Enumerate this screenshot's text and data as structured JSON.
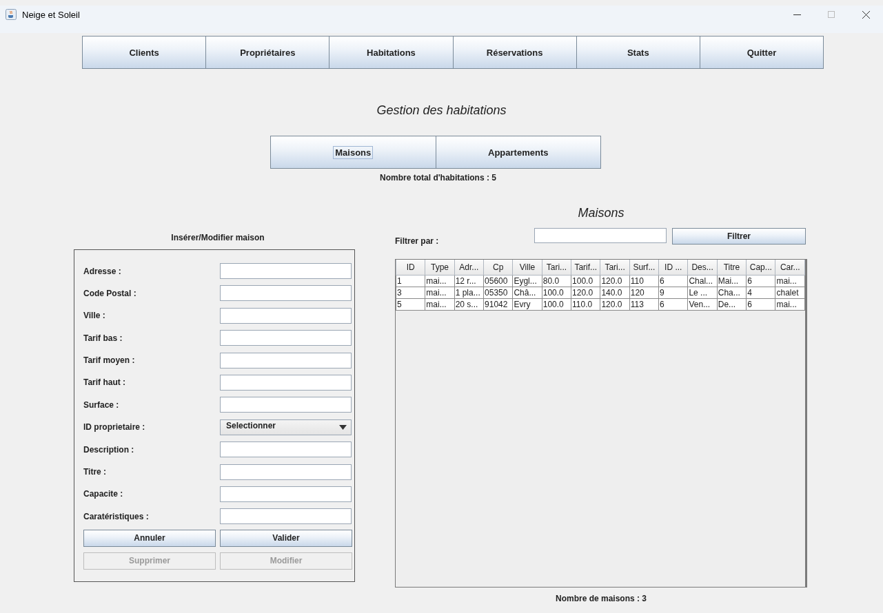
{
  "window": {
    "title": "Neige et Soleil"
  },
  "nav_buttons": [
    "Clients",
    "Propriétaires",
    "Habitations",
    "Réservations",
    "Stats",
    "Quitter"
  ],
  "heading": "Gestion des habitations",
  "sub_tabs": [
    {
      "label": "Maisons",
      "selected": true
    },
    {
      "label": "Appartements",
      "selected": false
    }
  ],
  "total_count": "Nombre total d'habitations : 5",
  "form": {
    "title": "Insérer/Modifier maison",
    "fields": [
      {
        "kind": "text",
        "label": "Adresse :"
      },
      {
        "kind": "text",
        "label": "Code Postal :"
      },
      {
        "kind": "text",
        "label": "Ville :"
      },
      {
        "kind": "text",
        "label": "Tarif bas :"
      },
      {
        "kind": "text",
        "label": "Tarif moyen :"
      },
      {
        "kind": "text",
        "label": "Tarif haut :"
      },
      {
        "kind": "text",
        "label": "Surface :"
      },
      {
        "kind": "combo",
        "label": "ID proprietaire :",
        "value": "Selectionner"
      },
      {
        "kind": "text",
        "label": "Description :"
      },
      {
        "kind": "text",
        "label": "Titre :"
      },
      {
        "kind": "text",
        "label": "Capacite :"
      },
      {
        "kind": "text",
        "label": "Caratéristiques :"
      }
    ],
    "buttons": [
      {
        "label": "Annuler",
        "disabled": false
      },
      {
        "label": "Valider",
        "disabled": false
      },
      {
        "label": "Supprimer",
        "disabled": true
      },
      {
        "label": "Modifier",
        "disabled": true
      }
    ]
  },
  "list": {
    "title": "Maisons",
    "filter_label": "Filtrer par :",
    "filter_button": "Filtrer",
    "table": {
      "columns": [
        "ID",
        "Type",
        "Adr...",
        "Cp",
        "Ville",
        "Tari...",
        "Tarif...",
        "Tari...",
        "Surf...",
        "ID ...",
        "Des...",
        "Titre",
        "Cap...",
        "Car..."
      ],
      "rows": [
        [
          "1",
          "mai...",
          "12 r...",
          "05600",
          "Eygl...",
          "80.0",
          "100.0",
          "120.0",
          "110",
          "6",
          "Chal...",
          "Mai...",
          "6",
          "mai..."
        ],
        [
          "3",
          "mai...",
          "1 pla...",
          "05350",
          "Châ...",
          "100.0",
          "120.0",
          "140.0",
          "120",
          "9",
          "Le ...",
          "Cha...",
          "4",
          "chalet"
        ],
        [
          "5",
          "mai...",
          "20 s...",
          "91042",
          "Evry",
          "100.0",
          "110.0",
          "120.0",
          "113",
          "6",
          "Ven...",
          "De...",
          "6",
          "mai..."
        ]
      ]
    },
    "count": "Nombre de maisons : 3"
  }
}
